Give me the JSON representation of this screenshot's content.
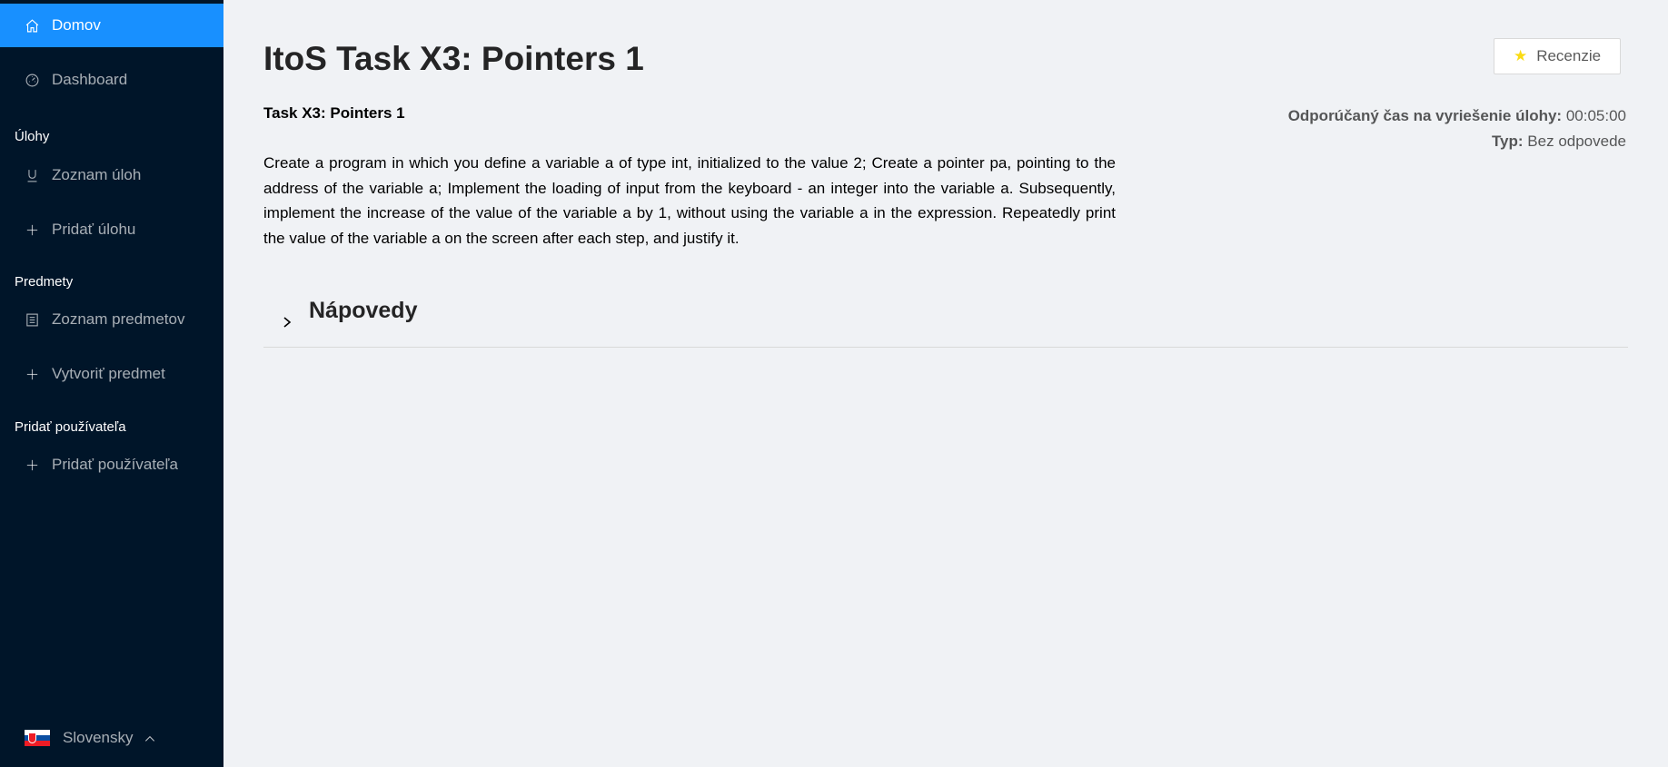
{
  "sidebar": {
    "home": "Domov",
    "dashboard": "Dashboard",
    "groups": {
      "tasks": "Úlohy",
      "subjects": "Predmety",
      "users": "Pridať používateľa"
    },
    "items": {
      "task_list": "Zoznam úloh",
      "add_task": "Pridať úlohu",
      "subject_list": "Zoznam predmetov",
      "create_subject": "Vytvoriť predmet",
      "add_user": "Pridať používateľa"
    },
    "language": "Slovensky",
    "active_color": "#1890ff",
    "background_color": "#001529"
  },
  "main": {
    "title": "ItoS Task X3: Pointers 1",
    "reviews_button": "Recenzie",
    "subtitle": "Task X3: Pointers 1",
    "meta": {
      "time_label": "Odporúčaný čas na vyriešenie úlohy:",
      "time_value": "00:05:00",
      "type_label": "Typ:",
      "type_value": "Bez odpovede"
    },
    "description": "Create a program in which you define a variable a of type int, initialized to the value 2; Create a pointer pa, pointing to the address of the variable a; Implement the loading of input from the keyboard - an integer into the variable a. Subsequently, implement the increase of the value of the variable a by 1, without using the variable a in the expression. Repeatedly print the value of the variable a on the screen after each step, and justify it.",
    "hints_header": "Nápovedy"
  }
}
